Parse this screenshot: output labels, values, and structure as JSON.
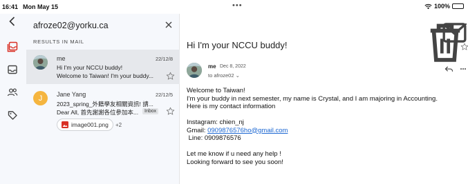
{
  "status_bar": {
    "time": "16:41",
    "date": "Mon May 15",
    "battery": "100%",
    "battery_level": 1.0
  },
  "rail": {
    "items": [
      {
        "icon": "mail-stack-icon",
        "active": true
      },
      {
        "icon": "inbox-icon",
        "active": false
      },
      {
        "icon": "people-icon",
        "active": false
      },
      {
        "icon": "label-icon",
        "active": false
      }
    ]
  },
  "search": {
    "query": "afroze02@yorku.ca",
    "results_label": "RESULTS IN MAIL"
  },
  "results": [
    {
      "sender": "me",
      "date": "22/12/8",
      "subject": "Hi I'm your NCCU buddy!",
      "snippet": "Welcome to Taiwan! I'm your buddy...",
      "selected": true
    },
    {
      "sender": "Jane Yang",
      "avatar_letter": "J",
      "date": "22/12/5",
      "subject": "2023_spring_外籍學友相關資訊! 請...",
      "snippet": "Dear All, 首先謝謝各位參加本...",
      "badge": "Inbox",
      "attachment": "image001.png",
      "more_attachments": "+2",
      "selected": false
    }
  ],
  "message": {
    "subject": "Hi I'm your NCCU buddy!",
    "sender": "me",
    "date": "Dec 8, 2022",
    "recipient": "to afroze02",
    "body": {
      "line1": "Welcome to Taiwan!",
      "line2": "I'm your buddy in next semester, my name is Crystal, and I am majoring in Accounting.",
      "line3": "Here is my contact information",
      "instagram": "Instagram: chien_nj",
      "gmail_label": "Gmail: ",
      "gmail_link": "0909876576ho@gmail.com",
      "line_id": " Line: 0909876576",
      "closing1": "Let me know if u need any help !",
      "closing2": "Looking forward to see you soon!"
    }
  },
  "colors": {
    "accent_red": "#d93025",
    "link_blue": "#1a66d2",
    "avatar_orange": "#f5b53f"
  }
}
